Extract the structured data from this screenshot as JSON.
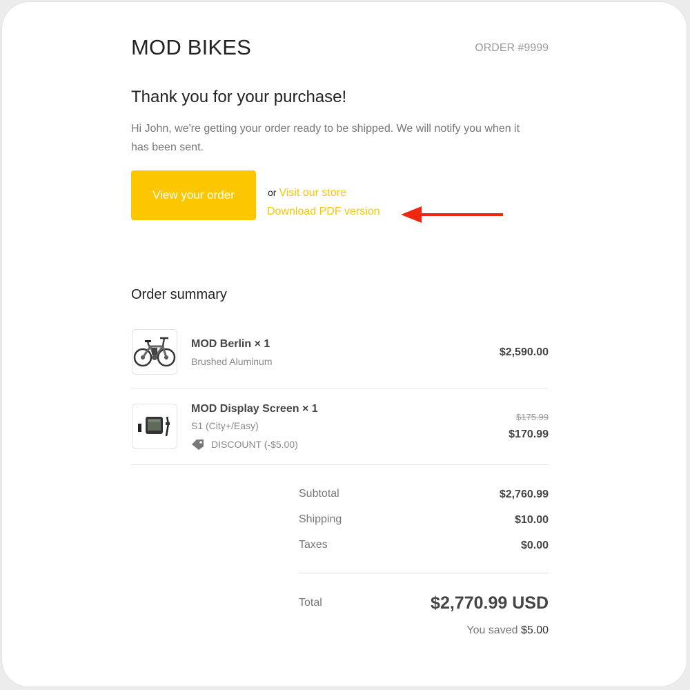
{
  "header": {
    "brand": "MOD BIKES",
    "order_number": "ORDER #9999"
  },
  "intro": {
    "heading": "Thank you for your purchase!",
    "message": "Hi John, we're getting your order ready to be shipped. We will notify you when it has been sent."
  },
  "actions": {
    "view_order_label": "View your order",
    "or_text": "or",
    "visit_store_label": "Visit our store",
    "download_pdf_label": "Download PDF version",
    "annotation_arrow_icon": "red-arrow-left-icon"
  },
  "summary": {
    "title": "Order summary",
    "items": [
      {
        "name": "MOD Berlin × 1",
        "variant": "Brushed Aluminum",
        "price": "$2,590.00",
        "image_icon": "bicycle-icon"
      },
      {
        "name": "MOD Display Screen × 1",
        "variant": "S1 (City+/Easy)",
        "discount": "DISCOUNT (-$5.00)",
        "old_price": "$175.99",
        "price": "$170.99",
        "image_icon": "display-screen-icon"
      }
    ]
  },
  "totals": {
    "subtotal_label": "Subtotal",
    "subtotal_value": "$2,760.99",
    "shipping_label": "Shipping",
    "shipping_value": "$10.00",
    "taxes_label": "Taxes",
    "taxes_value": "$0.00",
    "total_label": "Total",
    "total_value": "$2,770.99 USD",
    "saved_prefix": "You saved",
    "saved_amount": "$5.00"
  },
  "colors": {
    "accent": "#fcc600",
    "annotation": "#f0260f"
  }
}
